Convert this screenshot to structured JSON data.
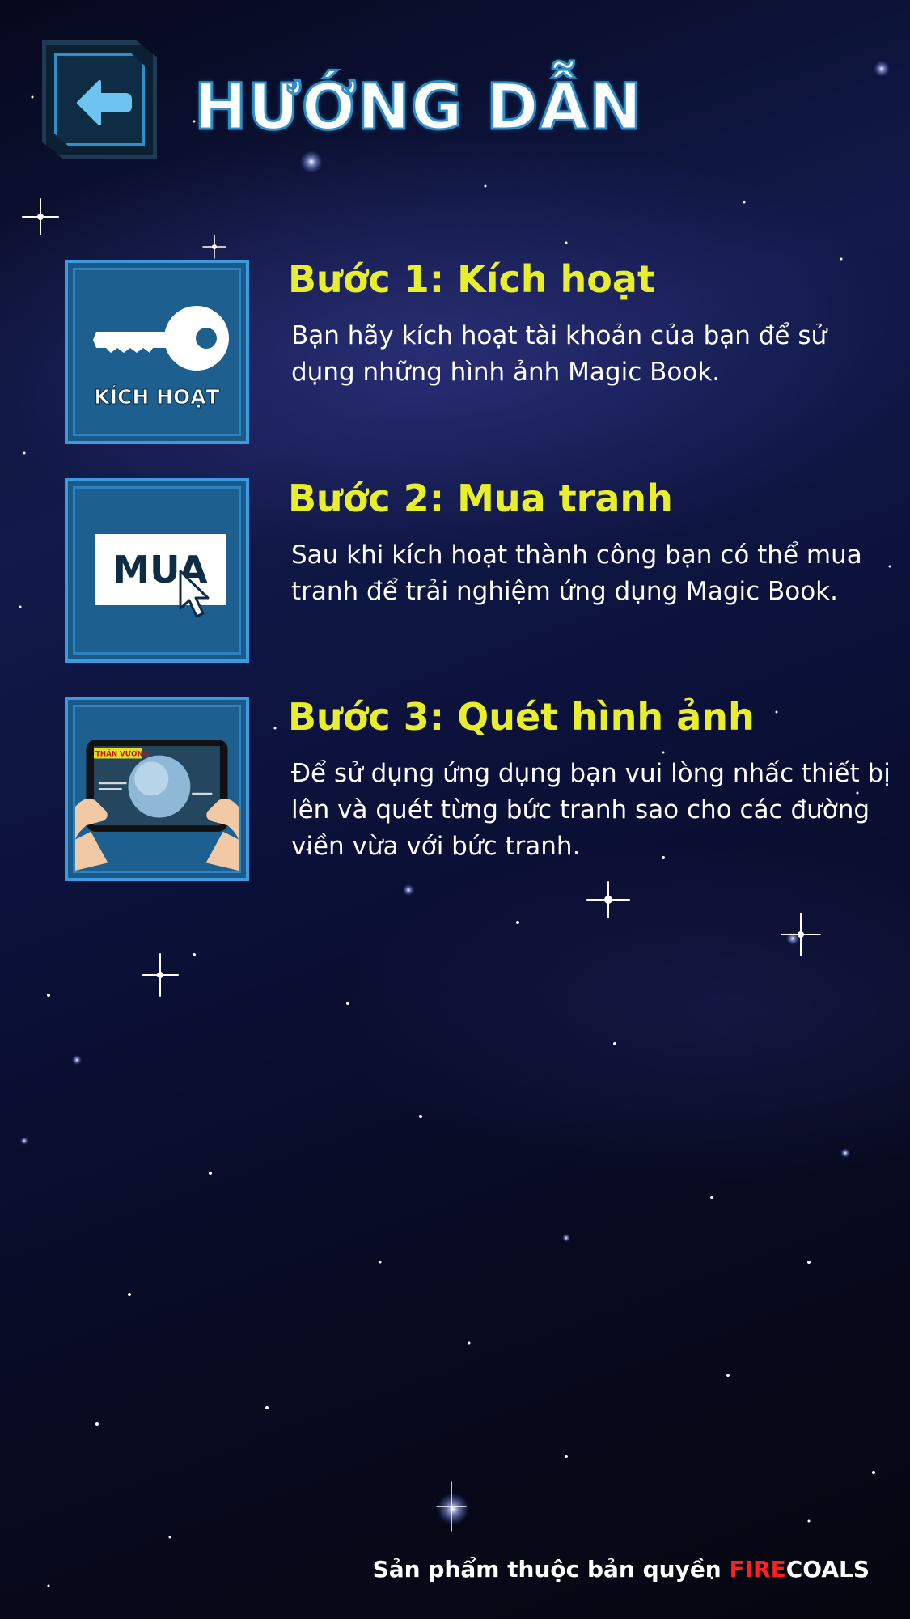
{
  "header": {
    "title": "HƯỚNG DẪN",
    "back_icon": "arrow-left-icon"
  },
  "steps": [
    {
      "title": "Bước 1: Kích hoạt",
      "description": "Bạn hãy kích hoạt tài khoản của bạn để sử dụng những hình ảnh Magic Book.",
      "icon": "key-icon",
      "icon_label": "KÍCH HOẠT"
    },
    {
      "title": "Bước 2: Mua tranh",
      "description": "Sau khi kích hoạt thành công bạn có thể mua tranh để trải nghiệm ứng dụng Magic Book.",
      "icon": "buy-icon",
      "icon_label": "MUA"
    },
    {
      "title": "Bước 3: Quét hình ảnh",
      "description": "Để sử dụng ứng dụng bạn vui lòng nhấc thiết bị lên và quét từng bức tranh sao cho các đường viền vừa với bức tranh.",
      "icon": "tablet-scan-icon",
      "icon_label": "THÂN VƯƠNG"
    }
  ],
  "footer": {
    "prefix": "Sản phẩm thuộc bản quyền ",
    "brand_part1": "FIRE",
    "brand_part2": "COALS"
  },
  "colors": {
    "title_outline": "#2f8fc8",
    "step_title": "#e8ef2a",
    "icon_bg": "#1b5a86",
    "brand_red": "#ff1f1f"
  }
}
